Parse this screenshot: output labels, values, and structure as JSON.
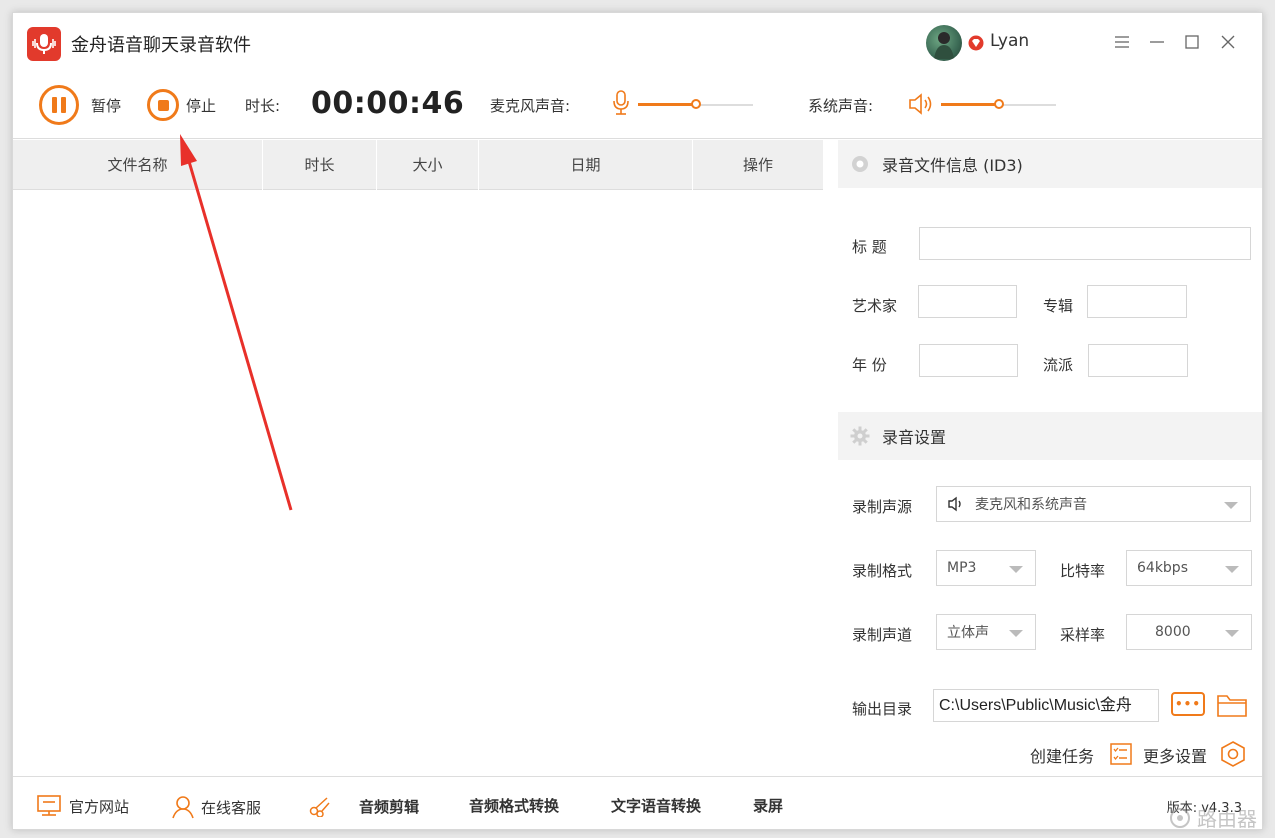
{
  "window": {
    "title": "金舟语音聊天录音软件",
    "username": "Lyan",
    "menu_icon": "hamburger-icon",
    "accent": "#f07a1a",
    "logo_color": "#e23a2c"
  },
  "toolbar": {
    "pause_label": "暂停",
    "stop_label": "停止",
    "duration_label": "时长:",
    "duration_value": "00:00:46",
    "mic_label": "麦克风声音:",
    "mic_level": 0.5,
    "system_label": "系统声音:",
    "system_level": 0.5
  },
  "table": {
    "columns": [
      "文件名称",
      "时长",
      "大小",
      "日期",
      "操作"
    ],
    "rows": []
  },
  "id3": {
    "header": "录音文件信息 (ID3)",
    "title_label": "标  题",
    "title_value": "",
    "artist_label": "艺术家",
    "artist_value": "",
    "album_label": "专辑",
    "album_value": "",
    "year_label": "年  份",
    "year_value": "",
    "genre_label": "流派",
    "genre_value": ""
  },
  "settings": {
    "header": "录音设置",
    "source_label": "录制声源",
    "source_value": "麦克风和系统声音",
    "format_label": "录制格式",
    "format_value": "MP3",
    "bitrate_label": "比特率",
    "bitrate_value": "64kbps",
    "channel_label": "录制声道",
    "channel_value": "立体声",
    "samplerate_label": "采样率",
    "samplerate_value": "8000",
    "output_label": "输出目录",
    "output_value": "C:\\Users\\Public\\Music\\金舟",
    "create_task_label": "创建任务",
    "more_settings_label": "更多设置"
  },
  "footer": {
    "website_label": "官方网站",
    "support_label": "在线客服",
    "audio_edit_label": "音频剪辑",
    "format_convert_label": "音频格式转换",
    "tts_label": "文字语音转换",
    "screen_record_label": "录屏",
    "version_label": "版本: v4.3.3"
  },
  "watermark": "路由器"
}
